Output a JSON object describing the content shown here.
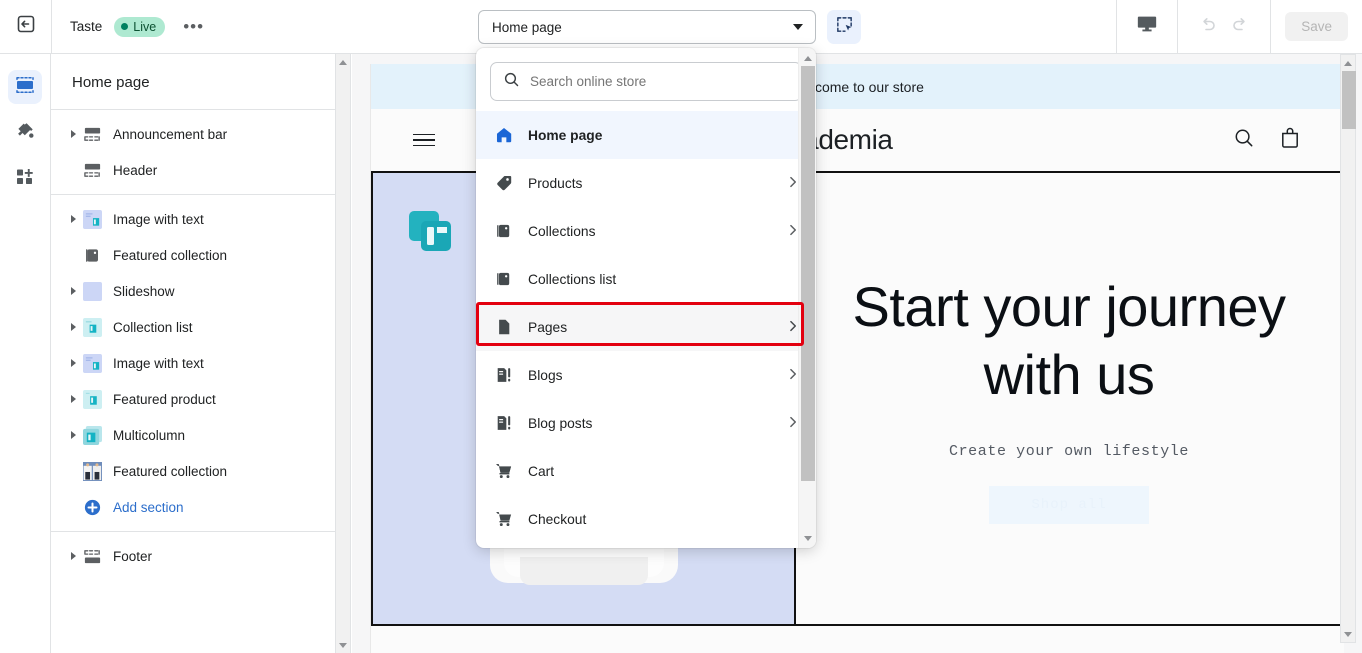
{
  "topbar": {
    "exit_icon": "exit-arrow-icon",
    "store_name": "Taste",
    "status_label": "Live",
    "more_label": "•••",
    "page_selector_value": "Home page",
    "inspect_icon": "inspector-select-icon",
    "device_icon": "desktop-monitor-icon",
    "undo_icon": "undo-arrow-icon",
    "redo_icon": "redo-arrow-icon",
    "save_label": "Save"
  },
  "rail": {
    "items": [
      {
        "icon": "sections-icon",
        "name": "sections",
        "active": true
      },
      {
        "icon": "paint-brush-icon",
        "name": "theme-settings",
        "active": false
      },
      {
        "icon": "apps-grid-icon",
        "name": "apps",
        "active": false
      }
    ]
  },
  "sidebar": {
    "title": "Home page",
    "groups": [
      {
        "items": [
          {
            "label": "Announcement bar",
            "icon": "announcement-bar-icon",
            "expandable": true
          },
          {
            "label": "Header",
            "icon": "header-icon",
            "expandable": false
          }
        ]
      },
      {
        "items": [
          {
            "label": "Image with text",
            "icon": "image-with-text-icon",
            "expandable": true
          },
          {
            "label": "Featured collection",
            "icon": "collection-tag-icon",
            "expandable": false
          },
          {
            "label": "Slideshow",
            "icon": "slideshow-icon",
            "expandable": true
          },
          {
            "label": "Collection list",
            "icon": "collection-list-icon",
            "expandable": true
          },
          {
            "label": "Image with text",
            "icon": "image-with-text-icon",
            "expandable": true
          },
          {
            "label": "Featured product",
            "icon": "featured-product-icon",
            "expandable": true
          },
          {
            "label": "Multicolumn",
            "icon": "multicolumn-icon",
            "expandable": true
          },
          {
            "label": "Featured collection",
            "icon": "featured-collection-photo-icon",
            "expandable": false
          },
          {
            "label": "Add section",
            "icon": "plus-circle-icon",
            "expandable": false,
            "accent": true
          }
        ]
      },
      {
        "items": [
          {
            "label": "Footer",
            "icon": "footer-icon",
            "expandable": true
          }
        ]
      }
    ]
  },
  "dropdown": {
    "search_placeholder": "Search online store",
    "search_value": "",
    "search_icon": "search-icon",
    "items": [
      {
        "label": "Home page",
        "icon": "home-icon",
        "has_submenu": false,
        "selected": true
      },
      {
        "label": "Products",
        "icon": "product-tag-icon",
        "has_submenu": true
      },
      {
        "label": "Collections",
        "icon": "collection-tag-icon",
        "has_submenu": true
      },
      {
        "label": "Collections list",
        "icon": "collection-tag-icon",
        "has_submenu": false
      },
      {
        "label": "Pages",
        "icon": "page-document-icon",
        "has_submenu": true,
        "highlighted": true
      },
      {
        "label": "Blogs",
        "icon": "blog-icon",
        "has_submenu": true
      },
      {
        "label": "Blog posts",
        "icon": "blog-icon",
        "has_submenu": true
      },
      {
        "label": "Cart",
        "icon": "cart-icon",
        "has_submenu": false
      },
      {
        "label": "Checkout",
        "icon": "cart-icon",
        "has_submenu": false
      }
    ],
    "chevron": "›"
  },
  "preview": {
    "announcement_text": "Welcome to our store",
    "brand_name": "academia",
    "menu_icon": "hamburger-menu-icon",
    "search_icon": "search-icon",
    "cart_icon": "shopping-bag-icon",
    "hero_heading": "Start your journey with us",
    "hero_subtext": "Create your own lifestyle",
    "hero_button": "Shop all"
  },
  "colors": {
    "accent_blue": "#2c6ecb",
    "highlight_red": "#e3000f",
    "live_green": "#008060",
    "announce_bg": "#e3f2fb",
    "panel_periwinkle": "#d4dcf4",
    "teal": "#23b2bf"
  }
}
